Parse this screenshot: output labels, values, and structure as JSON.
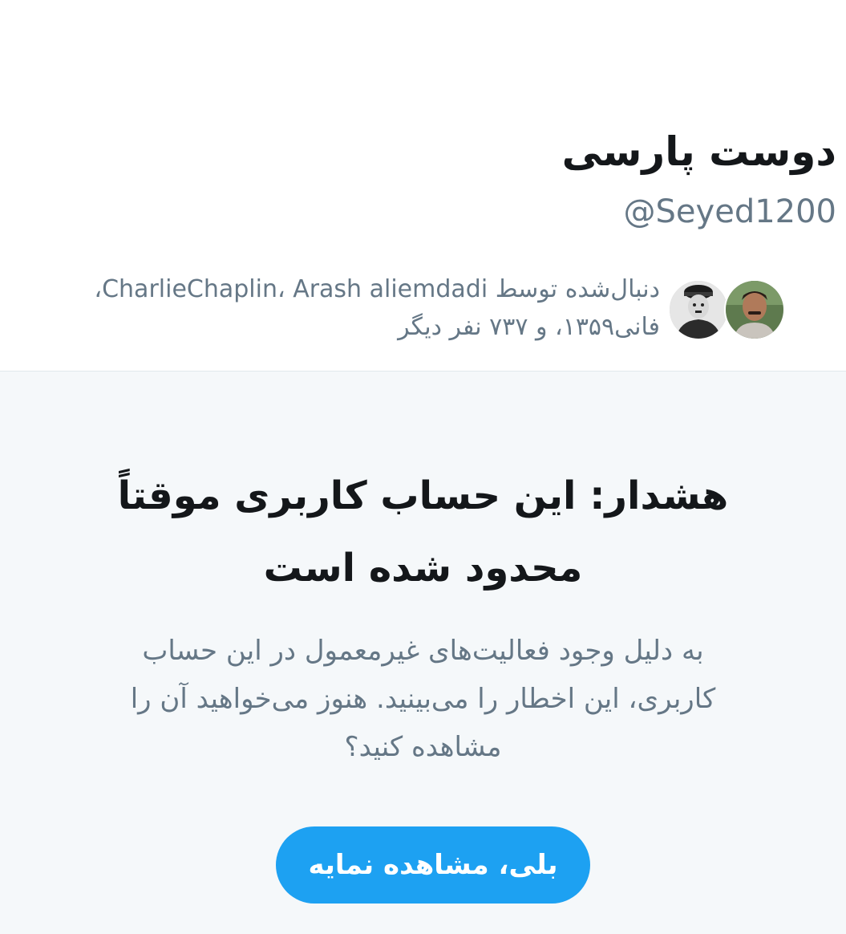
{
  "profile": {
    "display_name": "دوست پارسی",
    "handle": "@Seyed1200",
    "followed_by": {
      "line1_prefix": "دنبال‌شده توسط ",
      "line1_names": "CharlieChaplin، Arash aliemdadi،",
      "line2": "فانی۱۳۵۹، و ۷۳۷ نفر دیگر"
    }
  },
  "warning": {
    "title_line1": "هشدار: این حساب کاربری موقتاً",
    "title_line2": "محدود شده است",
    "body_line1": "به دلیل وجود فعالیت‌های غیرمعمول در این حساب",
    "body_line2": "کاربری، این اخطار را می‌بینید. هنوز می‌خواهید آن را",
    "body_line3": "مشاهده کنید؟",
    "button_label": "بلی، مشاهده نمایه"
  },
  "colors": {
    "accent": "#1da1f2",
    "text_primary": "#14171a",
    "text_secondary": "#657786",
    "warning_background": "#f5f8fa",
    "divider": "#e1e8ed"
  }
}
